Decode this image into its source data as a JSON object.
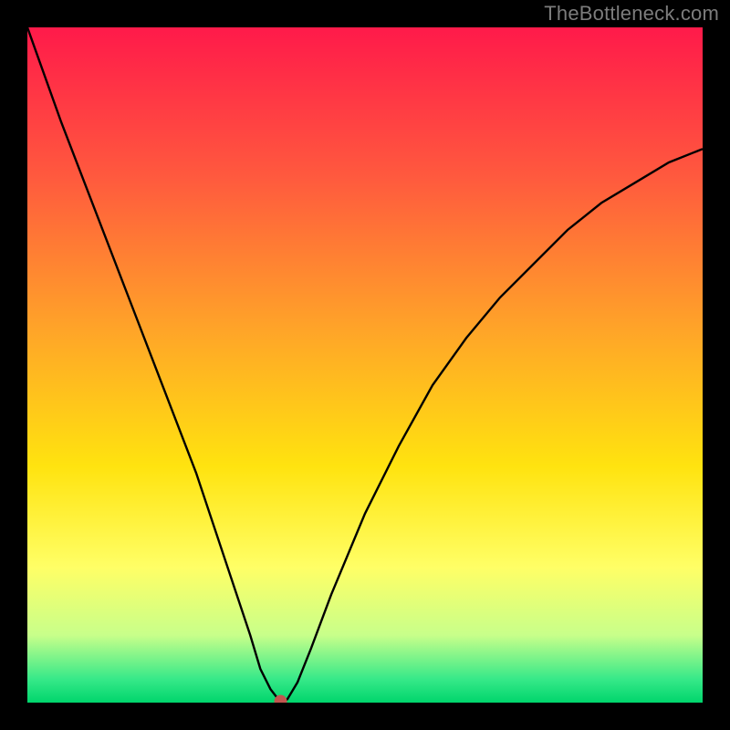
{
  "watermark": "TheBottleneck.com",
  "chart_data": {
    "type": "line",
    "title": "",
    "xlabel": "",
    "ylabel": "",
    "xlim": [
      0,
      100
    ],
    "ylim": [
      0,
      100
    ],
    "grid": false,
    "legend": false,
    "background_gradient": {
      "stops": [
        {
          "offset": 0.0,
          "color": "#ff1a4a"
        },
        {
          "offset": 0.22,
          "color": "#ff593e"
        },
        {
          "offset": 0.45,
          "color": "#ffa528"
        },
        {
          "offset": 0.65,
          "color": "#ffe30f"
        },
        {
          "offset": 0.8,
          "color": "#ffff66"
        },
        {
          "offset": 0.9,
          "color": "#c8ff8a"
        },
        {
          "offset": 0.965,
          "color": "#37e989"
        },
        {
          "offset": 1.0,
          "color": "#00d56c"
        }
      ]
    },
    "series": [
      {
        "name": "bottleneck-curve",
        "color": "#000000",
        "x": [
          0,
          5,
          10,
          15,
          20,
          25,
          28,
          31,
          33,
          34.5,
          36,
          37,
          37.8,
          38.5,
          40,
          42,
          45,
          50,
          55,
          60,
          65,
          70,
          75,
          80,
          85,
          90,
          95,
          100
        ],
        "y": [
          100,
          86,
          73,
          60,
          47,
          34,
          25,
          16,
          10,
          5,
          2,
          0.7,
          0.2,
          0.5,
          3,
          8,
          16,
          28,
          38,
          47,
          54,
          60,
          65,
          70,
          74,
          77,
          80,
          82
        ]
      }
    ],
    "marker": {
      "name": "optimal-point",
      "x": 37.5,
      "y": 0.2,
      "color": "#c1564f",
      "radius": 7
    }
  }
}
